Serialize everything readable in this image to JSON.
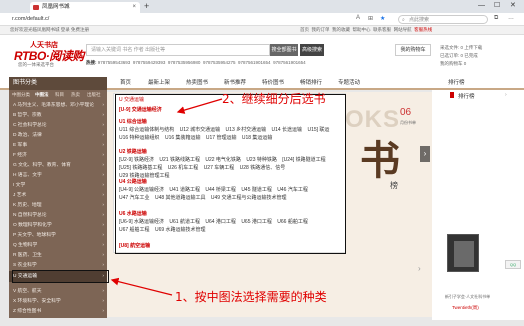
{
  "browser": {
    "tab_title": "凤凰网书城",
    "url": "r.com/default.c/",
    "search_placeholder": "点此搜索"
  },
  "top_strip": {
    "left_text": "您好欢迎光临凤凰网书城  登录  免费注册",
    "right_items": [
      "首页",
      "我的订单",
      "我的收藏",
      "帮助中心",
      "联系客服",
      "网站导航"
    ],
    "hotline": "客服热线"
  },
  "header": {
    "logo_top": "人天书店",
    "logo_main": "RTBO·阅读购",
    "logo_sub": "您的一体采选平台",
    "search_placeholder": "请输入关键词 书名 作者 出版社等",
    "search_button": "搜全部图书",
    "advanced_button": "高级搜索",
    "hot_label": "热搜:",
    "hot_keywords": [
      "9787559543693",
      "9787559429393",
      "9787535956980",
      "9787535954275",
      "9787561901654",
      "9787561901654"
    ],
    "cart_button": "我的购物车",
    "mini": [
      "采选文件: 0  上传下载",
      "已选订单: 0  已完成",
      "我的购物车 0"
    ]
  },
  "navbar": {
    "category_head": "图书分类",
    "items": [
      "首页",
      "最新上架",
      "热卖图书",
      "新书推荐",
      "特价图书",
      "畅销排行",
      "专题活动"
    ],
    "right_link": "排行榜"
  },
  "sidebar": {
    "tabs": [
      "中图法",
      "科目",
      "热卖",
      "出版社",
      "中图分类"
    ],
    "active_tab": 0,
    "categories": [
      "A 马列主义、毛泽东思想、邓小平理论",
      "B 哲学、宗教",
      "C 社会科学总论",
      "D 政治、法律",
      "E 军事",
      "F 经济",
      "G 文化、科学、教育、体育",
      "H 语言、文字",
      "I 文学",
      "J 艺术",
      "K 历史、地理",
      "N 自然科学总论",
      "O 数理科学和化学",
      "P 天文学、地球科学",
      "Q 生物科学",
      "R 医药、卫生",
      "S 农业科学",
      "T 工业技术",
      "U 交通运输",
      "V 航空、航天",
      "X 环境科学、安全科学",
      "Z 综合性图书"
    ],
    "selected_index": 18
  },
  "submenu": {
    "header": "U 交通运输",
    "sections": [
      {
        "title": "[U-9] 交通运输经济",
        "items": []
      },
      {
        "title": "U1 综合运输",
        "items": [
          "U11 综合运输体制与结构",
          "U12 城市交通运输",
          "U13 乡村交通运输",
          "U14 长途运输",
          "U15] 联运",
          "U16 特种运输组织",
          "U16 集装箱运输",
          "U17 管理运输",
          "U18 集运运输"
        ]
      },
      {
        "title": "U2 铁路运输",
        "items": [
          "[U2-9] 铁路经济",
          "U21 铁路线路工程",
          "U22 电气化铁路",
          "U23 特种铁路",
          "[U24] 铁路隧道工程",
          "[U25] 铁路路基工程",
          "U26 机车工程",
          "U27 车辆工程",
          "U28 铁路通信、信号",
          "U29 铁路运输管理工程"
        ]
      },
      {
        "title": "U4 公路运输",
        "items": [
          "[U4-9] 公路运输经济",
          "U41 道路工程",
          "U44 桥梁工程",
          "U45 隧道工程",
          "U46 汽车工程",
          "U47 汽车工业",
          "U48 其他道路运输工具",
          "U49 交通工程与公路运输技术管理"
        ]
      },
      {
        "title": "U6 水路运输",
        "items": [
          "[U6-9] 水路运输经济",
          "U61 航道工程",
          "U64 港口工程",
          "U65 港口工程",
          "U66 船舶工程",
          "U67 船舶工程",
          "U69 水路运输技术管理"
        ]
      },
      {
        "title": "[U8] 航空运输",
        "items": []
      }
    ]
  },
  "annotations": {
    "step1": "1、按中图法选择需要的种类",
    "step2": "2、继续细分后选书"
  },
  "banner": {
    "text_ks": "OKS",
    "text_shu": "书",
    "text_bang": "榜",
    "date": "06",
    "date_sub": "月份书单"
  },
  "right_column": {
    "title": "排行榜",
    "book_title": "新引子学会·人文社科书单",
    "price": "Twentieth(周)"
  },
  "colors": {
    "sidebar_bg": "#7d6555",
    "sidebar_selected": "#503e32",
    "accent_red": "#c00000",
    "annotation_red": "#e00000"
  }
}
